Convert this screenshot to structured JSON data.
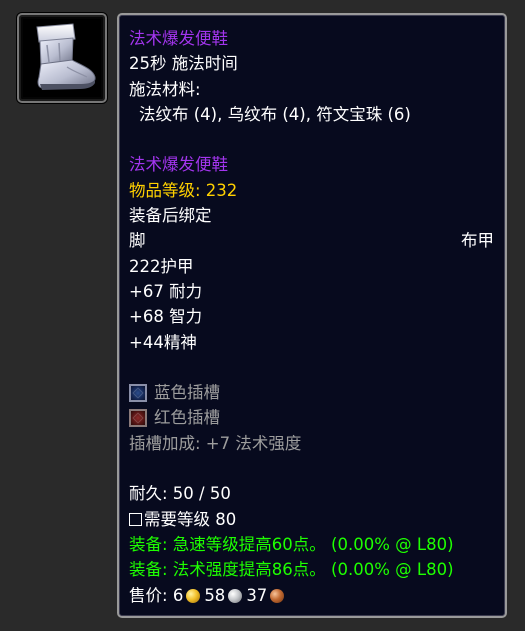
{
  "icon": {
    "name": "boots-icon"
  },
  "tooltip": {
    "recipe": {
      "title": "法术爆发便鞋",
      "cast_time": "25秒 施法时间",
      "reagents_label": "施法材料:",
      "reagents": "法纹布 (4), 乌纹布 (4), 符文宝珠 (6)"
    },
    "item": {
      "name": "法术爆发便鞋",
      "item_level": "物品等级: 232",
      "bind": "装备后绑定",
      "slot": "脚",
      "armor_type": "布甲",
      "armor": "222护甲",
      "stats": [
        "+67 耐力",
        "+68 智力",
        "+44精神"
      ],
      "sockets": [
        {
          "label": "蓝色插槽",
          "color": "#2c4d8c"
        },
        {
          "label": "红色插槽",
          "color": "#8c2a2a"
        }
      ],
      "socket_bonus": "插槽加成: +7 法术强度",
      "durability": "耐久: 50 / 50",
      "required_level": "需要等级 80",
      "equip_effects": [
        "装备: 急速等级提高60点。  (0.00% @ L80)",
        "装备: 法术强度提高86点。  (0.00% @ L80)"
      ],
      "sell_price": {
        "label": "售价: ",
        "gold": "6",
        "silver": "58",
        "copper": "37"
      }
    }
  },
  "colors": {
    "epic": "#a335ee",
    "gold": "#ffd100",
    "green": "#1eff00",
    "grey": "#9d9d9d",
    "background": "#070a1e"
  }
}
